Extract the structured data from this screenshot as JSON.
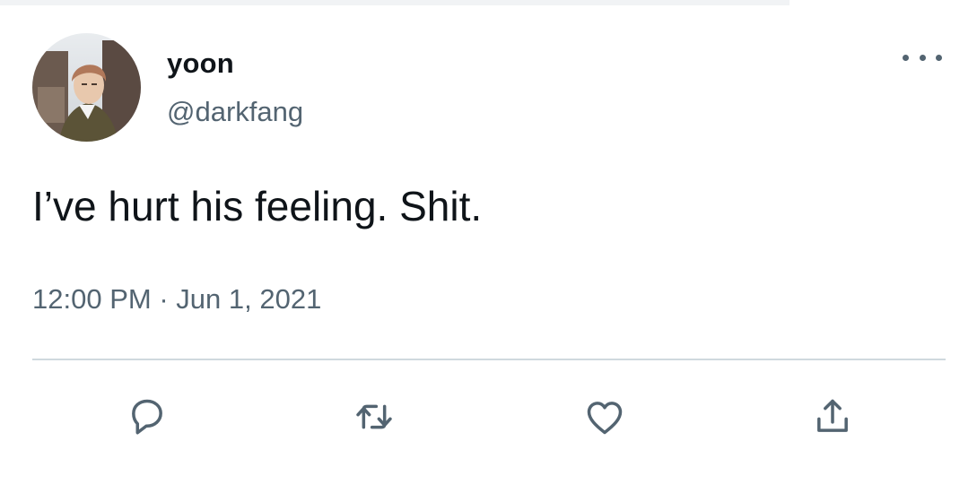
{
  "tweet": {
    "display_name": "yoon",
    "handle": "@darkfang",
    "text": "I’ve hurt his feeling. Shit.",
    "time": "12:00 PM",
    "separator": "·",
    "date": "Jun 1, 2021"
  },
  "icons": {
    "avatar": "profile-photo",
    "more": "more-dots-icon",
    "reply": "reply-bubble-icon",
    "retweet": "retweet-arrows-icon",
    "like": "heart-icon",
    "share": "share-upload-icon"
  },
  "colors": {
    "text_primary": "#0f1419",
    "text_secondary": "#536471",
    "divider": "#cfd9de"
  }
}
